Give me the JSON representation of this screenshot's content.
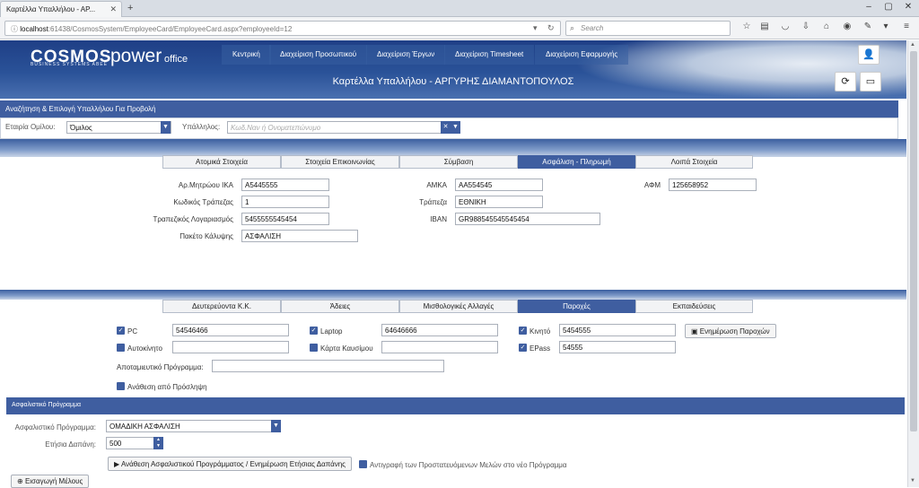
{
  "browser": {
    "tab_title": "Καρτέλλα Υπαλλήλου - ΑΡ...",
    "url_host": "localhost",
    "url_rest": ":61438/CosmosSystem/EmployeeCard/EmployeeCard.aspx?employeeId=12",
    "search_placeholder": "Search"
  },
  "brand": {
    "cosmos": "COSMOS",
    "cosmos_sub": "BUSINESS SYSTEMS ABEE",
    "power": "power",
    "office": "office"
  },
  "menu": [
    "Κεντρική",
    "Διαχείριση Προσωπικού",
    "Διαχείριση Έργων",
    "Διαχείριση Timesheet",
    "Διαχείριση Εφαρμογής"
  ],
  "page_title": "Καρτέλλα Υπαλλήλου - ΑΡΓΥΡΗΣ ΔΙΑΜΑΝΤΟΠΟΥΛΟΣ",
  "search_panel": {
    "header": "Αναζήτηση & Επιλογή Υπαλλήλου Για Προβολή",
    "company_label": "Εταιρία Ομίλου:",
    "company_value": "Όμιλος",
    "employee_label": "Υπάλληλος:",
    "employee_placeholder": "Κωδ.Ναν ή Ονοματεπώνυμο"
  },
  "tabs_top": [
    "Ατομικά Στοιχεία",
    "Στοιχεία Επικοινωνίας",
    "Σύμβαση",
    "Ασφάλιση - Πληρωμή",
    "Λοιπά Στοιχεία"
  ],
  "tabs_top_active": "Ασφάλιση - Πληρωμή",
  "insurance": {
    "ika_label": "Αρ.Μητρώου ΙΚΑ",
    "ika": "Α5445555",
    "bank_code_label": "Κωδικός Τράπεζας",
    "bank_code": "1",
    "account_label": "Τραπεζικός Λογαριασμός",
    "account": "5455555545454",
    "package_label": "Πακέτο Κάλυψης",
    "package": "ΑΣΦΑΛΙΣΗ",
    "amka_label": "ΑΜΚΑ",
    "amka": "ΑΑ554545",
    "bank_label": "Τράπεζα",
    "bank": "ΕΘΝΙΚΗ",
    "iban_label": "IBAN",
    "iban": "GR988545545545454",
    "afm_label": "ΑΦΜ",
    "afm": "125658952"
  },
  "tabs_bottom": [
    "Δευτερεύοντα Κ.Κ.",
    "Άδειες",
    "Μισθολογικές Αλλαγές",
    "Παροχές",
    "Εκπαιδεύσεις"
  ],
  "tabs_bottom_active": "Παροχές",
  "benefits": {
    "pc_label": "PC",
    "pc_checked": true,
    "pc": "54546466",
    "laptop_label": "Laptop",
    "laptop_checked": true,
    "laptop": "64646666",
    "mobile_label": "Κινητό",
    "mobile_checked": true,
    "mobile": "5454555",
    "car_label": "Αυτοκίνητο",
    "car_checked": false,
    "car": "",
    "fuel_label": "Κάρτα Καυσίμου",
    "fuel_checked": false,
    "fuel": "",
    "epass_label": "EPass",
    "epass_checked": true,
    "epass": "54555",
    "update_button": "Ενημέρωση Παροχών",
    "savings_label": "Αποταμιευτικό Πρόγραμμα:",
    "savings": "",
    "assign_label": "Ανάθεση από Πρόσληψη",
    "assign_checked": false
  },
  "insurance_program": {
    "header": "Ασφαλιστικό Πρόγραμμα",
    "program_label": "Ασφαλιστικό Πρόγραμμα:",
    "program_value": "ΟΜΑΔΙΚΗ ΑΣΦΑΛΙΣΗ",
    "cost_label": "Ετήσια Δαπάνη:",
    "cost_value": "500",
    "assign_button": "Ανάθεση Ασφαλιστικού Προγράμματος / Ενημέρωση Ετήσιας Δαπάνης",
    "copy_label": "Αντιγραφή των Προστατευόμενων Μελών στο νέο Πρόγραμμα",
    "copy_checked": false,
    "add_member_button": "Εισαγωγή Μέλους"
  },
  "colors": {
    "primary": "#3f5ea0",
    "header_dark": "#1f3f86"
  }
}
